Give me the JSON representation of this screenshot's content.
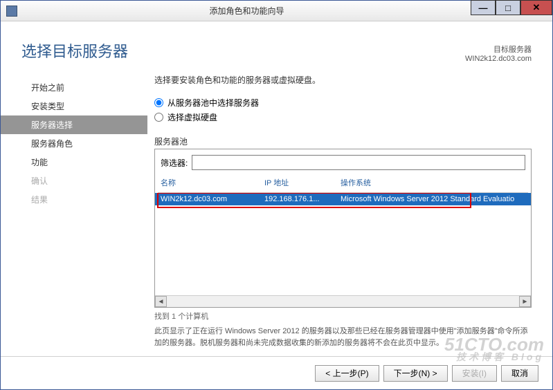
{
  "window": {
    "title": "添加角色和功能向导"
  },
  "page": {
    "heading": "选择目标服务器",
    "dest_label": "目标服务器",
    "dest_server": "WIN2k12.dc03.com"
  },
  "nav": {
    "items": [
      {
        "label": "开始之前",
        "state": "normal"
      },
      {
        "label": "安装类型",
        "state": "normal"
      },
      {
        "label": "服务器选择",
        "state": "active"
      },
      {
        "label": "服务器角色",
        "state": "normal"
      },
      {
        "label": "功能",
        "state": "normal"
      },
      {
        "label": "确认",
        "state": "disabled"
      },
      {
        "label": "结果",
        "state": "disabled"
      }
    ]
  },
  "main": {
    "instruction": "选择要安装角色和功能的服务器或虚拟硬盘。",
    "radio1": "从服务器池中选择服务器",
    "radio2": "选择虚拟硬盘",
    "pool_label": "服务器池",
    "filter_label": "筛选器:",
    "filter_value": "",
    "columns": {
      "name": "名称",
      "ip": "IP 地址",
      "os": "操作系统"
    },
    "servers": [
      {
        "name": "WIN2k12.dc03.com",
        "ip": "192.168.176.1...",
        "os": "Microsoft Windows Server 2012 Standard Evaluatio"
      }
    ],
    "found_text": "找到 1 个计算机",
    "info": "此页显示了正在运行 Windows Server 2012 的服务器以及那些已经在服务器管理器中使用\"添加服务器\"命令所添加的服务器。脱机服务器和尚未完成数据收集的新添加的服务器将不会在此页中显示。"
  },
  "footer": {
    "prev": "< 上一步(P)",
    "next": "下一步(N) >",
    "install": "安装(I)",
    "cancel": "取消"
  },
  "watermark": {
    "main": "51CTO.com",
    "sub": "技术博客  Blog"
  }
}
